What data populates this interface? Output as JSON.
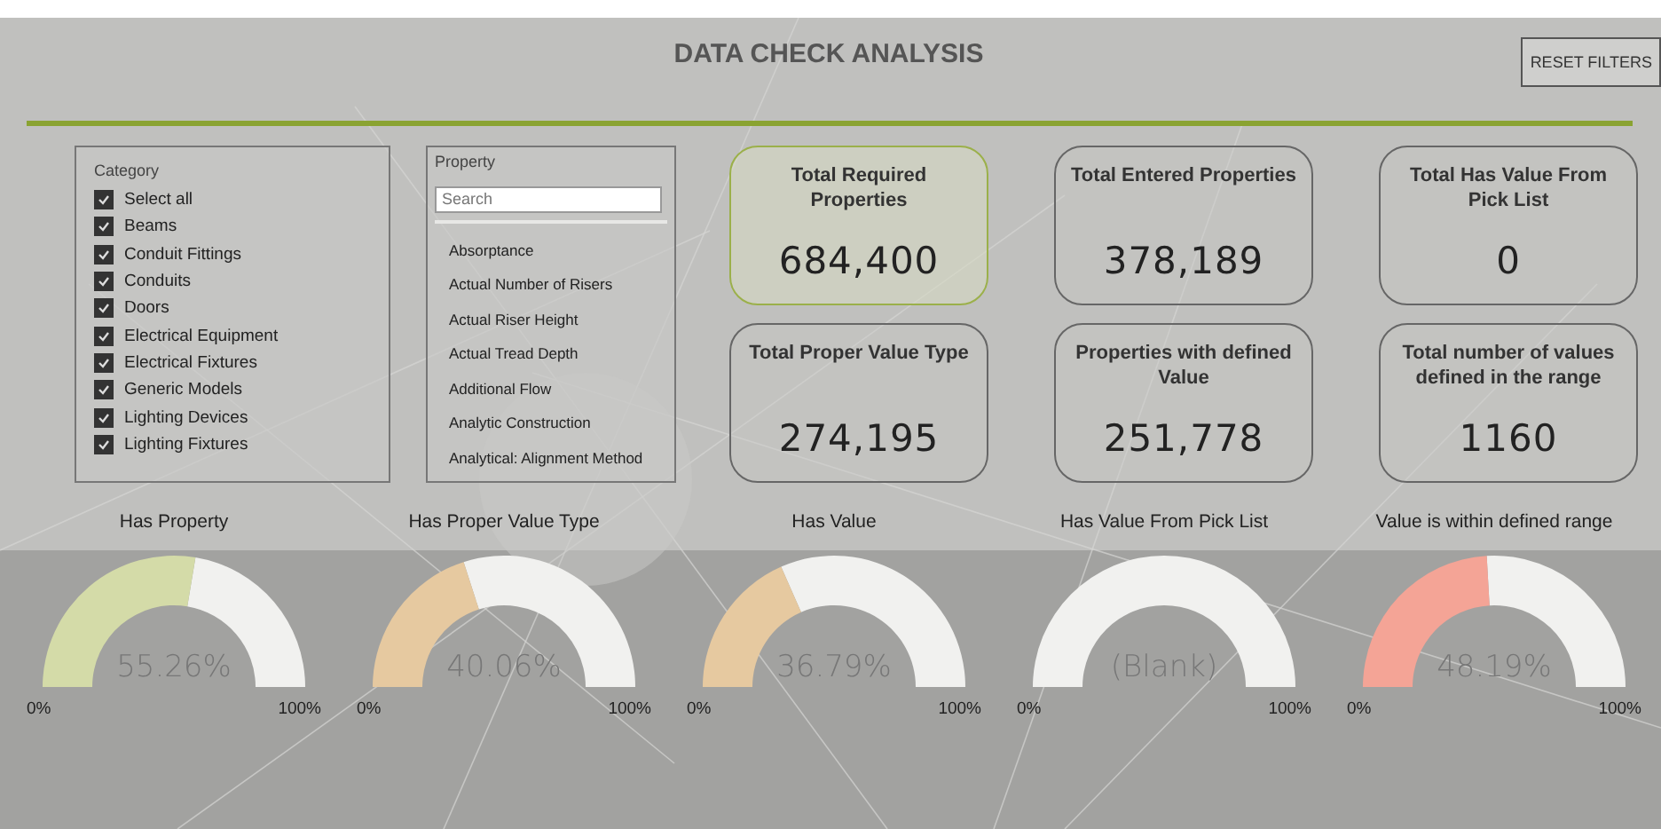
{
  "title": "DATA CHECK ANALYSIS",
  "reset_button": "RESET FILTERS",
  "category_filter": {
    "heading": "Category",
    "items": [
      {
        "label": "Select all",
        "checked": true
      },
      {
        "label": "Beams",
        "checked": true
      },
      {
        "label": "Conduit Fittings",
        "checked": true
      },
      {
        "label": "Conduits",
        "checked": true
      },
      {
        "label": "Doors",
        "checked": true
      },
      {
        "label": "Electrical Equipment",
        "checked": true
      },
      {
        "label": "Electrical Fixtures",
        "checked": true
      },
      {
        "label": "Generic Models",
        "checked": true
      },
      {
        "label": "Lighting Devices",
        "checked": true
      },
      {
        "label": "Lighting Fixtures",
        "checked": true
      }
    ]
  },
  "property_filter": {
    "heading": "Property",
    "placeholder": "Search",
    "items": [
      "Absorptance",
      "Actual Number of Risers",
      "Actual Riser Height",
      "Actual Tread Depth",
      "Additional Flow",
      "Analytic Construction",
      "Analytical: Alignment Method"
    ]
  },
  "cards": [
    {
      "label": "Total Required Properties",
      "value": "684,400",
      "selected": true
    },
    {
      "label": "Total Entered Properties",
      "value": "378,189",
      "selected": false
    },
    {
      "label": "Total Has Value From Pick List",
      "value": "0",
      "selected": false
    },
    {
      "label": "Total Proper Value Type",
      "value": "274,195",
      "selected": false
    },
    {
      "label": "Properties with defined Value",
      "value": "251,778",
      "selected": false
    },
    {
      "label": "Total number of values defined in the range",
      "value": "1160",
      "selected": false
    }
  ],
  "gauges": [
    {
      "title": "Has Property",
      "reading": "55.26%",
      "min": "0%",
      "max": "100%"
    },
    {
      "title": "Has Proper Value Type",
      "reading": "40.06%",
      "min": "0%",
      "max": "100%"
    },
    {
      "title": "Has Value",
      "reading": "36.79%",
      "min": "0%",
      "max": "100%"
    },
    {
      "title": "Has Value From Pick List",
      "reading": "(Blank)",
      "min": "0%",
      "max": "100%"
    },
    {
      "title": "Value is within defined range",
      "reading": "48.19%",
      "min": "0%",
      "max": "100%"
    }
  ]
}
